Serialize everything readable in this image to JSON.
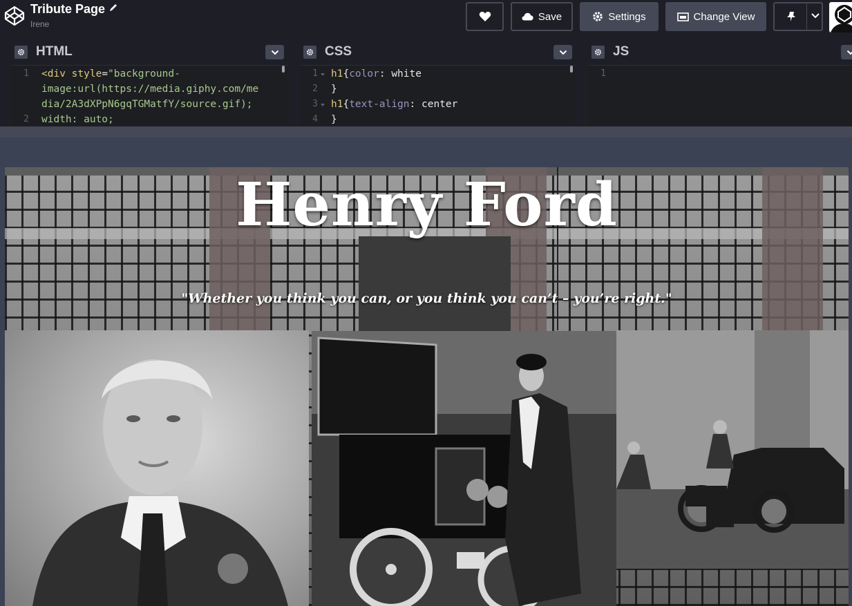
{
  "app": {
    "title": "Tribute Page",
    "owner": "Irene"
  },
  "toolbar": {
    "save_label": "Save",
    "settings_label": "Settings",
    "change_view_label": "Change View"
  },
  "editors": {
    "html": {
      "title": "HTML",
      "line_numbers": [
        "1",
        "2"
      ],
      "lines": [
        {
          "tag": "<div ",
          "attr": "style",
          "eq": "=",
          "str": "\"background-"
        },
        {
          "str": "image:url(https://media.giphy.com/me"
        },
        {
          "str": "dia/2A3dXPpN6gqTGMatfY/source.gif);"
        },
        {
          "str": "width: auto;"
        }
      ]
    },
    "css": {
      "title": "CSS",
      "line_numbers": [
        "1",
        "2",
        "3",
        "4"
      ],
      "lines": [
        {
          "sel": "h1",
          "open": "{",
          "prop": "color",
          "colon": ": ",
          "val": "white"
        },
        {
          "close": "}"
        },
        {
          "sel": "h1",
          "open": "{",
          "prop": "text-align",
          "colon": ": ",
          "val": "center"
        },
        {
          "close": "}"
        }
      ]
    },
    "js": {
      "title": "JS",
      "line_numbers": [
        "1"
      ]
    }
  },
  "preview": {
    "heading": "Henry Ford",
    "quote": "\"Whether you think you can, or you think you can’t – you’re right.\""
  },
  "colors": {
    "toolbar_bg": "#1e1f26",
    "button_gray": "#444857",
    "code_string": "#a8c98e",
    "code_tag": "#ddca7e",
    "code_prop": "#9a94bf"
  }
}
